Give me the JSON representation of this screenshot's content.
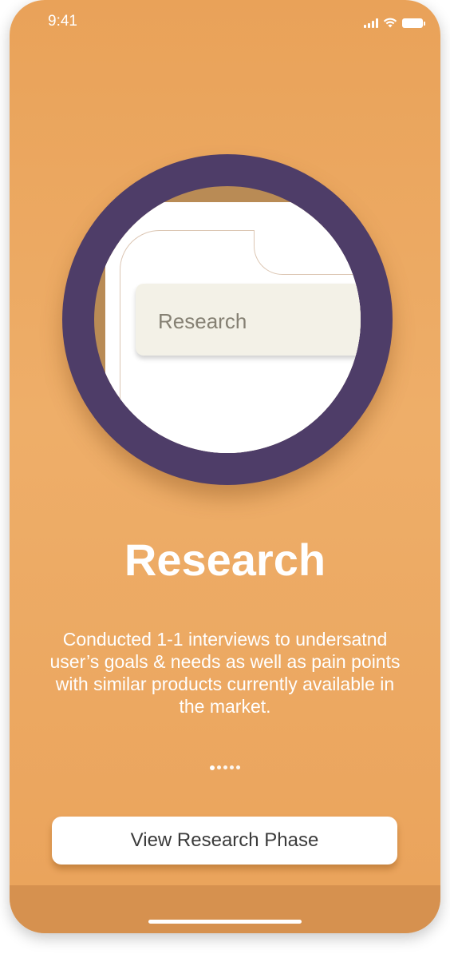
{
  "status_bar": {
    "time": "9:41",
    "icons": [
      "signal-icon",
      "wifi-icon",
      "battery-icon"
    ]
  },
  "illustration": {
    "chip_label": "Research"
  },
  "onboarding": {
    "title": "Research",
    "description": "Conducted 1-1 interviews to undersatnd user’s goals & needs as well as pain points with similar products currently available in the market.",
    "page_index": 1,
    "page_count": 5
  },
  "actions": {
    "primary_label": "View Research Phase"
  },
  "colors": {
    "background": "#eeae69",
    "magnifier_ring": "#4e3d68",
    "bottom_bar": "#d6914f",
    "button_text": "#3b3b3b"
  }
}
